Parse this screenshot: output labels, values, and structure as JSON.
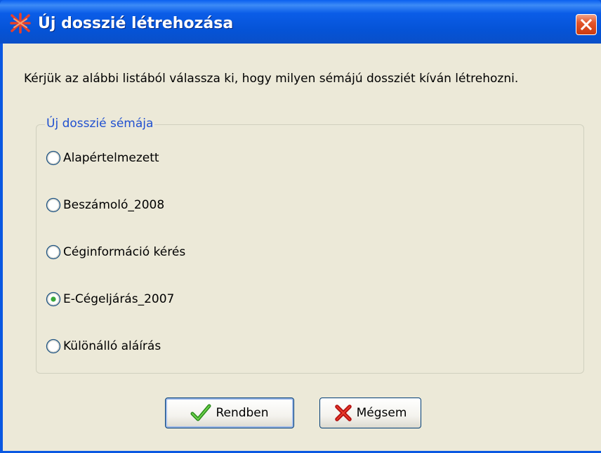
{
  "window": {
    "title": "Új dosszié létrehozása",
    "icon": "dossier-app-icon"
  },
  "prompt": "Kérjük az alábbi listából válassza ki, hogy milyen sémájú dossziét kíván létrehozni.",
  "group": {
    "legend": "Új dosszié sémája",
    "options": [
      {
        "label": "Alapértelmezett",
        "selected": false
      },
      {
        "label": "Beszámoló_2008",
        "selected": false
      },
      {
        "label": "Céginformáció kérés",
        "selected": false
      },
      {
        "label": "E-Cégeljárás_2007",
        "selected": true
      },
      {
        "label": "Különálló aláírás",
        "selected": false
      }
    ]
  },
  "buttons": {
    "ok": {
      "label": "Rendben",
      "icon": "checkmark-icon"
    },
    "cancel": {
      "label": "Mégsem",
      "icon": "x-icon"
    }
  },
  "colors": {
    "titlebar": "#0553d6",
    "dialog_bg": "#ece9d8",
    "legend_text": "#2050d0",
    "close_button": "#e2542a"
  }
}
